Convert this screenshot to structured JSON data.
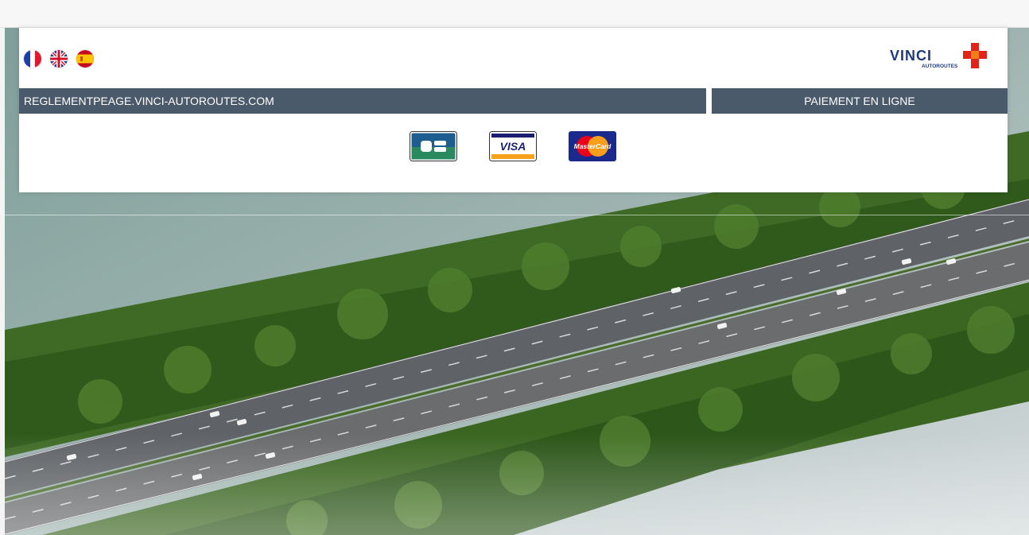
{
  "header": {
    "languages": [
      {
        "code": "fr",
        "icon": "france-flag-icon"
      },
      {
        "code": "en",
        "icon": "uk-flag-icon"
      },
      {
        "code": "es",
        "icon": "spain-flag-icon"
      }
    ],
    "logo": {
      "brand": "VINCI",
      "sub": "AUTOROUTES",
      "icon": "vinci-autoroutes-logo"
    }
  },
  "nav": {
    "site_label": "REGLEMENTPEAGE.VINCI-AUTOROUTES.COM",
    "section_label": "PAIEMENT EN LIGNE"
  },
  "payment_cards": [
    {
      "name": "CB",
      "icon": "cb-card-icon"
    },
    {
      "name": "VISA",
      "icon": "visa-card-icon"
    },
    {
      "name": "MasterCard",
      "icon": "mastercard-card-icon"
    }
  ],
  "colors": {
    "bar": "#4b5a6b",
    "vinci_blue": "#1f3a7a",
    "vinci_red": "#e2231a"
  }
}
